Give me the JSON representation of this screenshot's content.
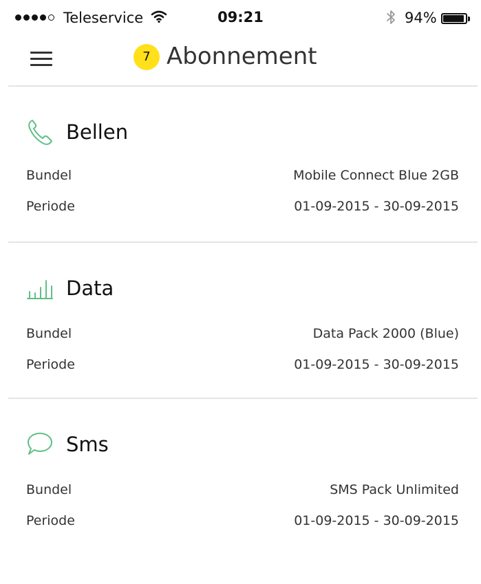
{
  "status": {
    "carrier": "Teleservice",
    "time": "09:21",
    "battery": "94%",
    "battery_level": 0.94
  },
  "header": {
    "badge": "7",
    "title": "Abonnement"
  },
  "sections": [
    {
      "icon": "phone-icon",
      "title": "Bellen",
      "rows": [
        {
          "label": "Bundel",
          "value": "Mobile Connect Blue 2GB"
        },
        {
          "label": "Periode",
          "value": "01-09-2015 - 30-09-2015"
        }
      ]
    },
    {
      "icon": "data-bars-icon",
      "title": "Data",
      "rows": [
        {
          "label": "Bundel",
          "value": "Data Pack 2000 (Blue)"
        },
        {
          "label": "Periode",
          "value": "01-09-2015 - 30-09-2015"
        }
      ]
    },
    {
      "icon": "speech-bubble-icon",
      "title": "Sms",
      "rows": [
        {
          "label": "Bundel",
          "value": "SMS Pack Unlimited"
        },
        {
          "label": "Periode",
          "value": "01-09-2015 - 30-09-2015"
        }
      ]
    }
  ],
  "colors": {
    "accent": "#5FBF86",
    "badge": "#FFE01B"
  }
}
